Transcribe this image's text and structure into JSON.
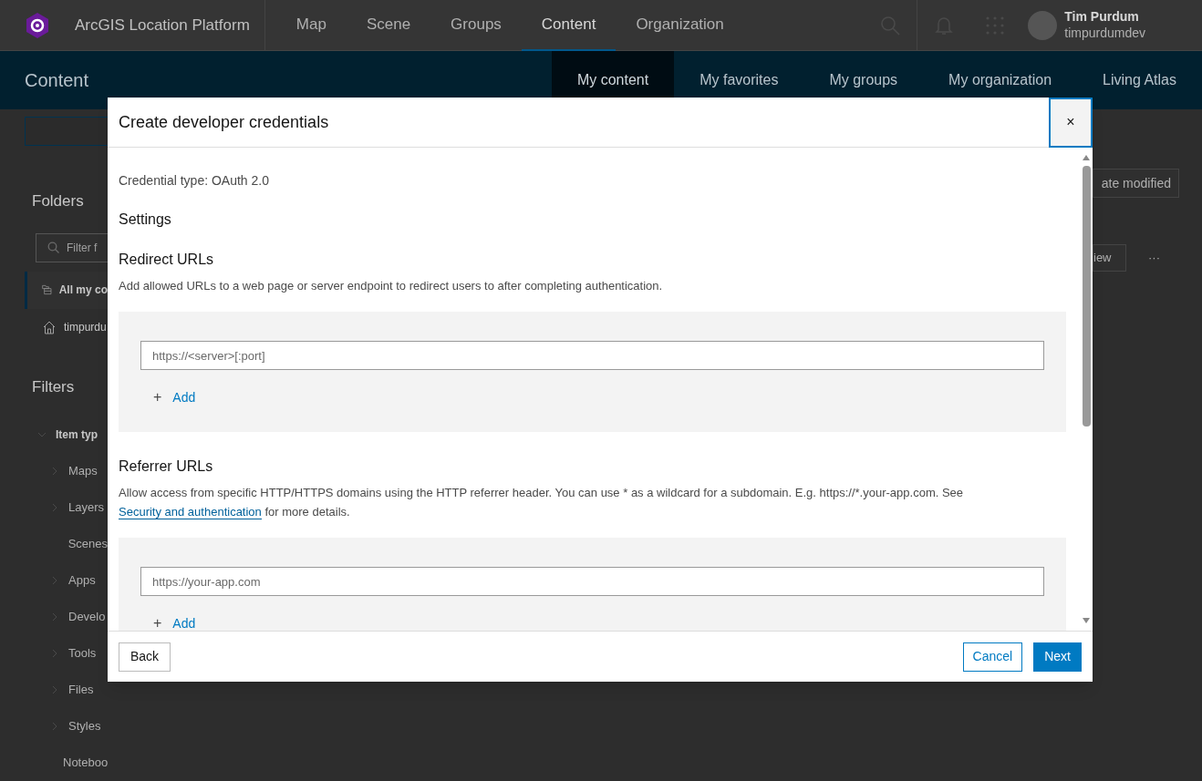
{
  "header": {
    "brand": "ArcGIS Location Platform",
    "nav": [
      {
        "label": "Map",
        "selected": false
      },
      {
        "label": "Scene",
        "selected": false
      },
      {
        "label": "Groups",
        "selected": false
      },
      {
        "label": "Content",
        "selected": true
      },
      {
        "label": "Organization",
        "selected": false
      }
    ],
    "user": {
      "name": "Tim Purdum",
      "username": "timpurdumdev"
    }
  },
  "subheader": {
    "title": "Content",
    "tabs": [
      {
        "label": "My content",
        "selected": true
      },
      {
        "label": "My favorites",
        "selected": false
      },
      {
        "label": "My groups",
        "selected": false
      },
      {
        "label": "My organization",
        "selected": false
      },
      {
        "label": "Living Atlas",
        "selected": false
      }
    ]
  },
  "sidebar": {
    "folders_title": "Folders",
    "filter_placeholder": "Filter f",
    "folders": [
      {
        "label": "All my co",
        "selected": true
      },
      {
        "label": "timpurdu",
        "selected": false
      }
    ],
    "filters_title": "Filters",
    "item_type": {
      "label": "Item typ",
      "expanded": true,
      "children": [
        {
          "label": "Maps",
          "expandable": true
        },
        {
          "label": "Layers",
          "expandable": true
        },
        {
          "label": "Scenes",
          "expandable": false
        },
        {
          "label": "Apps",
          "expandable": true
        },
        {
          "label": "Develo",
          "expandable": true
        },
        {
          "label": "Tools",
          "expandable": true
        },
        {
          "label": "Files",
          "expandable": true
        },
        {
          "label": "Styles",
          "expandable": true
        },
        {
          "label": "Noteboo",
          "expandable": false
        }
      ]
    }
  },
  "right_strip": {
    "sort_button": "ate modified",
    "view_button": "iew",
    "more_button": "···"
  },
  "dialog": {
    "title": "Create developer credentials",
    "close": "×",
    "credential_type": "Credential type: OAuth 2.0",
    "settings_heading": "Settings",
    "sections": [
      {
        "heading": "Redirect URLs",
        "description": "Add allowed URLs to a web page or server endpoint to redirect users to after completing authentication.",
        "placeholder": "https://<server>[:port]",
        "add_icon": "+",
        "add_label": "Add"
      },
      {
        "heading": "Referrer URLs",
        "description": "Allow access from specific HTTP/HTTPS domains using the HTTP referrer header. You can use * as a wildcard for a subdomain. E.g. https://*.your-app.com. See",
        "link": "Security and authentication",
        "description_after": "for more details.",
        "placeholder": "https://your-app.com",
        "add_icon": "+",
        "add_label": "Add"
      }
    ],
    "back": "Back",
    "cancel": "Cancel",
    "next": "Next"
  }
}
